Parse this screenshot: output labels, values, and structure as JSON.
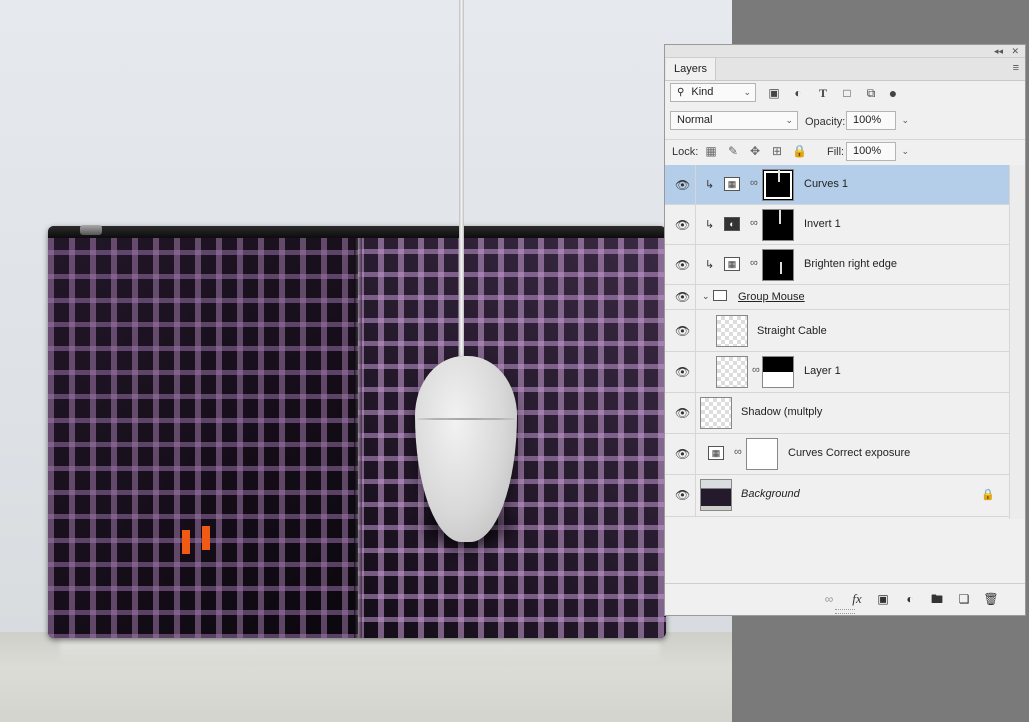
{
  "panel": {
    "collapse_label": "◂◂",
    "close_label": "✕",
    "tab": "Layers",
    "menu_label": "≡"
  },
  "filter": {
    "kind_label": "Kind",
    "icons": [
      "image-filter-icon",
      "adjustment-filter-icon",
      "type-filter-icon",
      "shape-filter-icon",
      "smart-object-filter-icon",
      "filter-toggle-icon"
    ]
  },
  "blend": {
    "mode": "Normal",
    "opacity_label": "Opacity:",
    "opacity_value": "100%"
  },
  "lock": {
    "label": "Lock:",
    "fill_label": "Fill:",
    "fill_value": "100%"
  },
  "layers": [
    {
      "name": "Curves 1",
      "selected": true
    },
    {
      "name": "Invert 1"
    },
    {
      "name": "Brighten right edge"
    },
    {
      "name": "Group Mouse"
    },
    {
      "name": "Straight Cable"
    },
    {
      "name": "Layer 1"
    },
    {
      "name": "Shadow (multply"
    },
    {
      "name": "Curves Correct exposure"
    },
    {
      "name": "Background"
    }
  ],
  "footer": {
    "fx_label": "fx"
  },
  "colors": {
    "selection": "#b4cde8",
    "accent_orange": "#f05a14"
  }
}
